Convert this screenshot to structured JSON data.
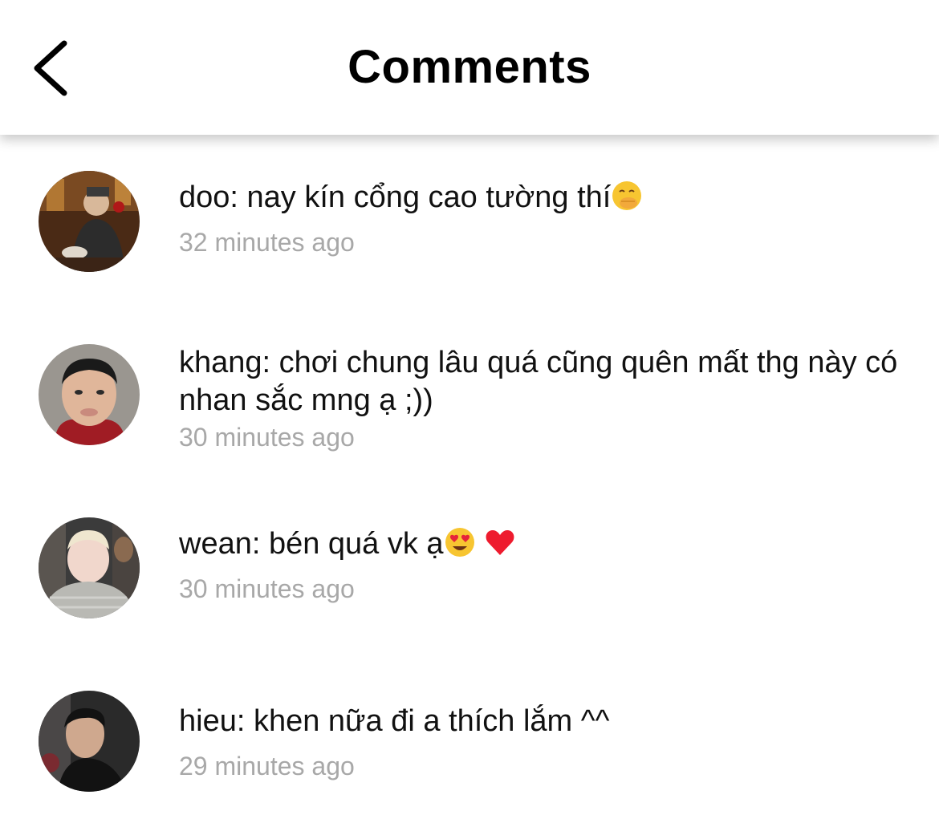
{
  "header": {
    "title": "Comments",
    "back_icon": "chevron-left-icon"
  },
  "comments": [
    {
      "username": "doo",
      "text": "doo: nay kín cổng cao tường thí",
      "emoji": "hand-over-mouth-emoji",
      "time": "32 minutes ago"
    },
    {
      "username": "khang",
      "text": "khang: chơi chung lâu quá cũng quên mất thg này có nhan sắc mng ạ ;))",
      "time": "30 minutes ago"
    },
    {
      "username": "wean",
      "text": "wean: bén quá vk ạ",
      "emoji": [
        "heart-eyes-emoji",
        "red-heart-emoji"
      ],
      "time": "30 minutes ago"
    },
    {
      "username": "hieu",
      "text": "hieu: khen nữa đi a thích lắm ^^",
      "time": "29 minutes ago"
    }
  ]
}
